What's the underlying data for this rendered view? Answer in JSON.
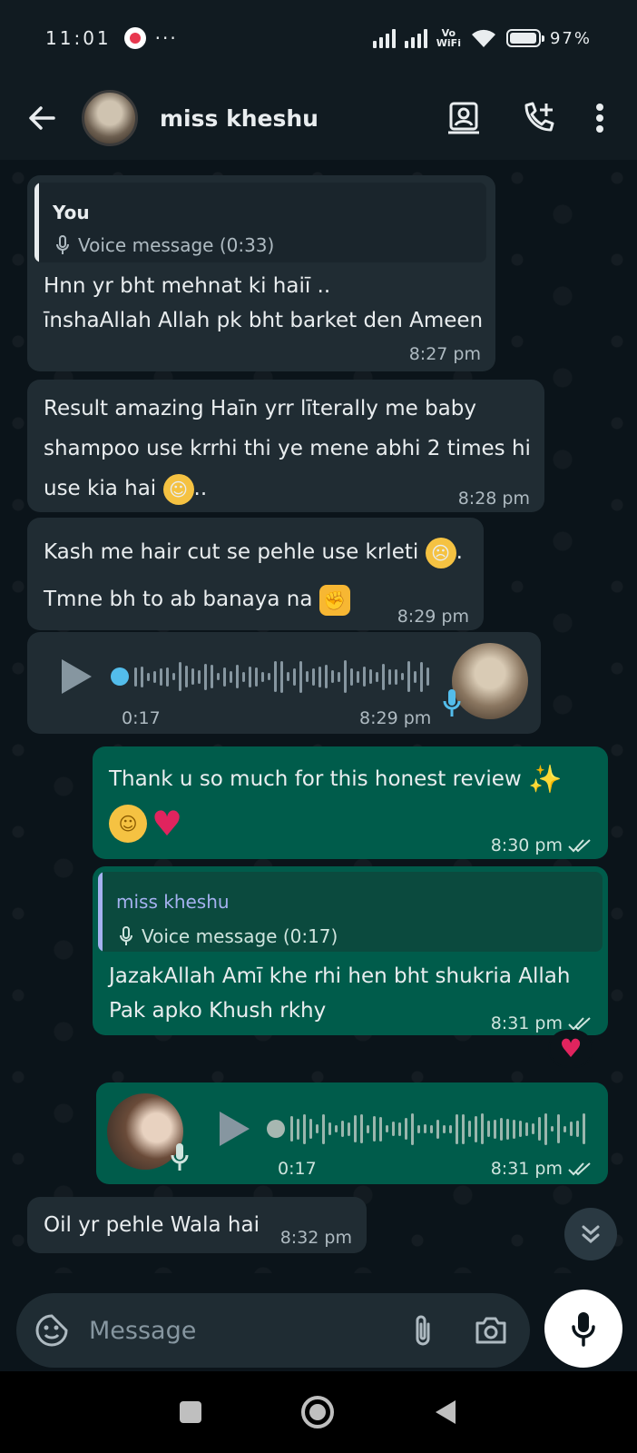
{
  "status_bar": {
    "time": "11:01",
    "more": "···",
    "vowifi_top": "Vo",
    "vowifi_bottom": "WiFi",
    "battery": "97%",
    "battery_level": 0.97
  },
  "header": {
    "contact_name": "miss kheshu"
  },
  "messages": {
    "m1": {
      "quote_author": "You",
      "quote_text": "Voice message (0:33)",
      "line1": "Hnn yr bht mehnat ki haiī ..",
      "line2": "īnshaAllah Allah pk bht barket den Ameen",
      "time": "8:27 pm"
    },
    "m2": {
      "line1": "Result  amazing Haīn yrr līterally me baby",
      "line2": "shampoo use krrhi thi ye mene abhi 2 times hi",
      "line3": "use kia hai",
      "line3_suffix": "..",
      "time": "8:28 pm"
    },
    "m3": {
      "line1": "Kash me hair cut se pehle use krleti",
      "line1_suffix": ".",
      "line2": "Tmne bh to ab banaya na",
      "time": "8:29 pm"
    },
    "m4": {
      "duration": "0:17",
      "time": "8:29 pm"
    },
    "m5": {
      "line1": "Thank u so much for this honest review",
      "time": "8:30 pm"
    },
    "m6": {
      "quote_author": "miss kheshu",
      "quote_text": "Voice message (0:17)",
      "line1": "JazakAllah Amī khe rhi hen bht shukria Allah",
      "line2": "Pak apko Khush rkhy",
      "time": "8:31 pm"
    },
    "m7": {
      "duration": "0:17",
      "time": "8:31 pm"
    },
    "m8": {
      "text": "Oil yr pehle Wala hai",
      "time": "8:32 pm"
    }
  },
  "composer": {
    "placeholder": "Message"
  },
  "icons": {
    "back": "arrow-left-icon",
    "gallery": "contact-card-icon",
    "call": "add-call-icon",
    "menu": "more-vertical-icon",
    "sticker": "sticker-icon",
    "attach": "paperclip-icon",
    "camera": "camera-icon",
    "mic": "mic-icon"
  },
  "colors": {
    "incoming": "#202c33",
    "outgoing": "#005c4b",
    "background": "#0b141a",
    "accent": "#53bdeb"
  }
}
